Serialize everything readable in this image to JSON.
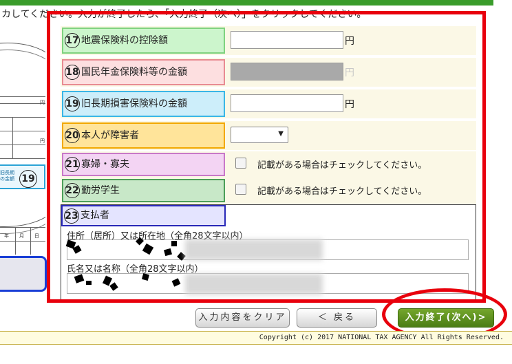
{
  "instruction": "カしてください。入力が終了したら、「入力終了（次へ）」をクリックしてください。",
  "rows": [
    {
      "num": "17",
      "label": "地震保険料の控除額",
      "type": "text",
      "value": "",
      "unit": "円",
      "color": "#ccf5cc",
      "border": "#7fd27f"
    },
    {
      "num": "18",
      "label": "国民年金保険料等の金額",
      "type": "text-disabled",
      "value": "",
      "unit": "円",
      "color": "#fddfe0",
      "border": "#e88b92"
    },
    {
      "num": "19",
      "label": "旧長期損害保険料の金額",
      "type": "text",
      "value": "",
      "unit": "円",
      "color": "#cdeefa",
      "border": "#3ab6e6"
    },
    {
      "num": "20",
      "label": "本人が障害者",
      "type": "select",
      "value": "",
      "color": "#ffe49a",
      "border": "#f2a800"
    },
    {
      "num": "21",
      "label": "寡婦・寡夫",
      "type": "checkbox",
      "check_text": "記載がある場合はチェックしてください。",
      "color": "#f3d4f3",
      "border": "#c878c8"
    },
    {
      "num": "22",
      "label": "勤労学生",
      "type": "checkbox",
      "check_text": "記載がある場合はチェックしてください。",
      "color": "#c8e8c8",
      "border": "#4c9e58"
    }
  ],
  "payer": {
    "num": "23",
    "label": "支払者",
    "address_label": "住所（居所）又は所在地（全角28文字以内）",
    "name_label": "氏名又は名称（全角28文字以内）"
  },
  "left_doc": {
    "badge_num": "19",
    "badge_text_1": "旧長期",
    "badge_text_2": "の金額",
    "tiny_1": "円",
    "tiny_2": "年",
    "tiny_3": "月",
    "tiny_4": "日"
  },
  "buttons": {
    "clear": "入力内容をクリア",
    "back": "＜ 戻る",
    "next": "入力終了(次へ)>"
  },
  "copyright": "Copyright (c) 2017 NATIONAL TAX AGENCY All Rights Reserved.",
  "colors": {
    "accent_red": "#e8000c",
    "next_green": "#5a8c1c",
    "top_bar": "#3a9c2b"
  }
}
